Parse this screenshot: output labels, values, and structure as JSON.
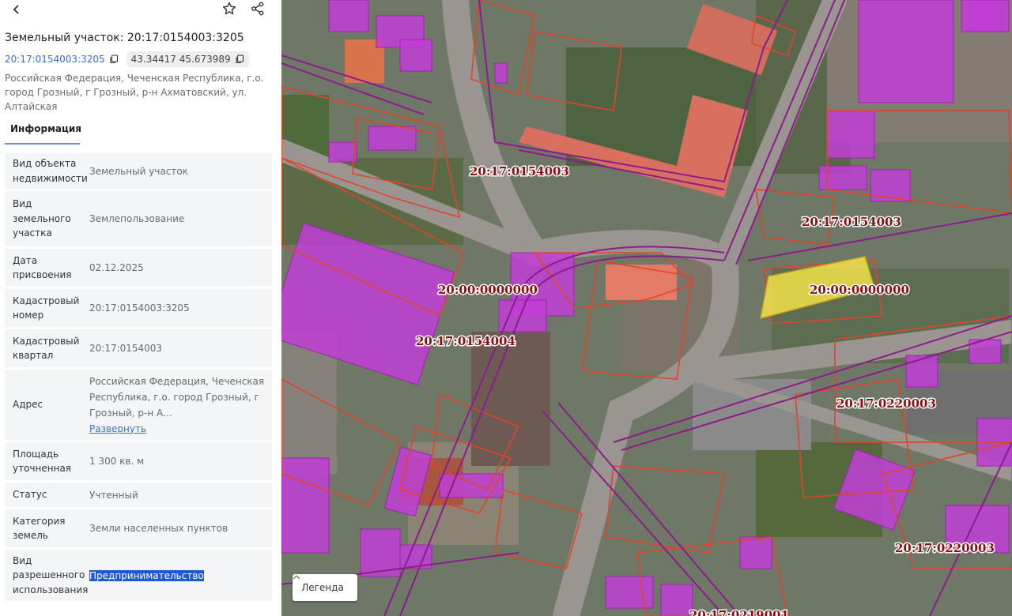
{
  "panel": {
    "title": "Земельный участок: 20:17:0154003:3205",
    "cadastral_link": "20:17:0154003:3205",
    "coordinates": "43.34417 45.673989",
    "address": "Российская Федерация, Чеченская Республика, г.о. город Грозный, г Грозный, р-н Ахматовский, ул. Алтайская",
    "tab_info": "Информация",
    "rows": [
      {
        "label": "Вид объекта недвижимости",
        "value": "Земельный участок"
      },
      {
        "label": "Вид земельного участка",
        "value": "Землепользование"
      },
      {
        "label": "Дата присвоения",
        "value": "02.12.2025"
      },
      {
        "label": "Кадастровый номер",
        "value": "20:17:0154003:3205"
      },
      {
        "label": "Кадастровый квартал",
        "value": "20:17:0154003"
      },
      {
        "label": "Адрес",
        "value": "Российская Федерация, Чеченская Республика, г.о. город Грозный, г Грозный, р-н А...",
        "link": "Развернуть"
      },
      {
        "label": "Площадь уточненная",
        "value": "1 300 кв. м"
      },
      {
        "label": "Статус",
        "value": "Учтенный"
      },
      {
        "label": "Категория земель",
        "value": "Земли населенных пунктов"
      },
      {
        "label": "Вид разрешенного использования",
        "value": "Предпринимательство"
      }
    ]
  },
  "icons": {
    "back": "chevron-left-icon",
    "favorite": "star-icon",
    "share": "share-icon",
    "copy": "copy-icon",
    "legend_toggle": "chevron-up-icon"
  },
  "map": {
    "legend_button": "Легенда",
    "labels": {
      "block_a": "20:17:0154003",
      "block_b": "20:17:0154003",
      "block_c": "20:00:0000000",
      "block_d": "20:00:0000000",
      "block_e": "20:17:0154004",
      "block_f": "20:17:0220003",
      "block_g": "20:17:0220003",
      "block_h": "20:17:0219001"
    },
    "colors": {
      "selected_parcel": "#f2e24a",
      "parcel_outline": "#e0452a",
      "building_fill": "#c13ed6",
      "quarter_line": "#8a1d8a",
      "label_text": "#8a0e0e"
    }
  }
}
